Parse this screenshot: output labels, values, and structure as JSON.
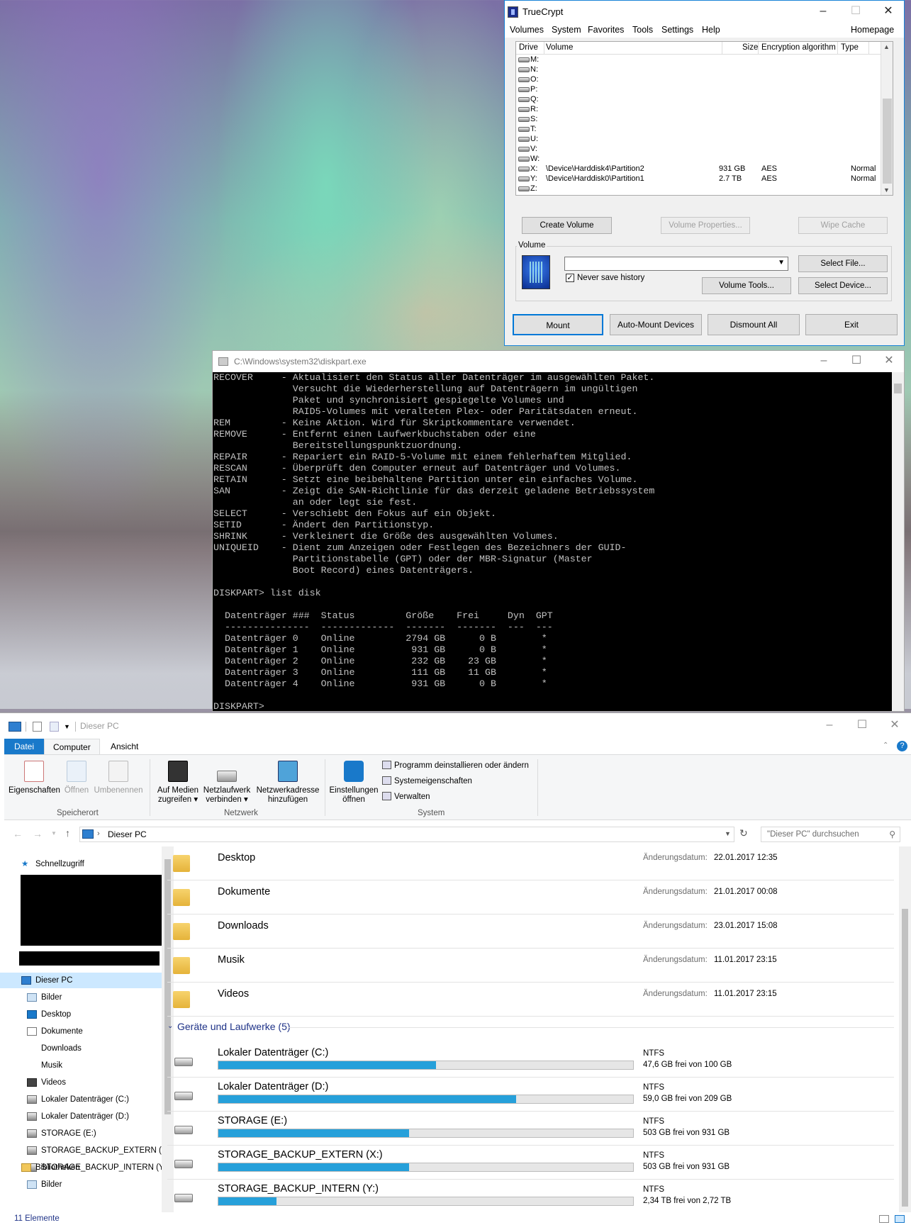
{
  "truecrypt": {
    "title": "TrueCrypt",
    "menu": [
      "Volumes",
      "System",
      "Favorites",
      "Tools",
      "Settings",
      "Help"
    ],
    "homepage": "Homepage",
    "columns": {
      "drive": "Drive",
      "volume": "Volume",
      "size": "Size",
      "algorithm": "Encryption algorithm",
      "type": "Type"
    },
    "rows": [
      {
        "drive": "M:",
        "volume": "",
        "size": "",
        "algorithm": "",
        "type": ""
      },
      {
        "drive": "N:",
        "volume": "",
        "size": "",
        "algorithm": "",
        "type": ""
      },
      {
        "drive": "O:",
        "volume": "",
        "size": "",
        "algorithm": "",
        "type": ""
      },
      {
        "drive": "P:",
        "volume": "",
        "size": "",
        "algorithm": "",
        "type": ""
      },
      {
        "drive": "Q:",
        "volume": "",
        "size": "",
        "algorithm": "",
        "type": ""
      },
      {
        "drive": "R:",
        "volume": "",
        "size": "",
        "algorithm": "",
        "type": ""
      },
      {
        "drive": "S:",
        "volume": "",
        "size": "",
        "algorithm": "",
        "type": ""
      },
      {
        "drive": "T:",
        "volume": "",
        "size": "",
        "algorithm": "",
        "type": ""
      },
      {
        "drive": "U:",
        "volume": "",
        "size": "",
        "algorithm": "",
        "type": ""
      },
      {
        "drive": "V:",
        "volume": "",
        "size": "",
        "algorithm": "",
        "type": ""
      },
      {
        "drive": "W:",
        "volume": "",
        "size": "",
        "algorithm": "",
        "type": ""
      },
      {
        "drive": "X:",
        "volume": "\\Device\\Harddisk4\\Partition2",
        "size": "931 GB",
        "algorithm": "AES",
        "type": "Normal"
      },
      {
        "drive": "Y:",
        "volume": "\\Device\\Harddisk0\\Partition1",
        "size": "2.7 TB",
        "algorithm": "AES",
        "type": "Normal"
      },
      {
        "drive": "Z:",
        "volume": "",
        "size": "",
        "algorithm": "",
        "type": ""
      }
    ],
    "buttons": {
      "create_volume": "Create Volume",
      "volume_properties": "Volume Properties...",
      "wipe_cache": "Wipe Cache",
      "select_file": "Select File...",
      "volume_tools": "Volume Tools...",
      "select_device": "Select Device...",
      "mount": "Mount",
      "auto_mount": "Auto-Mount Devices",
      "dismount_all": "Dismount All",
      "exit": "Exit"
    },
    "volume_group_label": "Volume",
    "never_save_history": "Never save history",
    "never_save_history_checked": true,
    "volume_path": ""
  },
  "console": {
    "title": "C:\\Windows\\system32\\diskpart.exe",
    "lines": [
      "RECOVER     - Aktualisiert den Status aller Datenträger im ausgewählten Paket.",
      "              Versucht die Wiederherstellung auf Datenträgern im ungültigen",
      "              Paket und synchronisiert gespiegelte Volumes und",
      "              RAID5-Volumes mit veralteten Plex- oder Paritätsdaten erneut.",
      "REM         - Keine Aktion. Wird für Skriptkommentare verwendet.",
      "REMOVE      - Entfernt einen Laufwerkbuchstaben oder eine",
      "              Bereitstellungspunktzuordnung.",
      "REPAIR      - Repariert ein RAID-5-Volume mit einem fehlerhaftem Mitglied.",
      "RESCAN      - Überprüft den Computer erneut auf Datenträger und Volumes.",
      "RETAIN      - Setzt eine beibehaltene Partition unter ein einfaches Volume.",
      "SAN         - Zeigt die SAN-Richtlinie für das derzeit geladene Betriebssystem",
      "              an oder legt sie fest.",
      "SELECT      - Verschiebt den Fokus auf ein Objekt.",
      "SETID       - Ändert den Partitionstyp.",
      "SHRINK      - Verkleinert die Größe des ausgewählten Volumes.",
      "UNIQUEID    - Dient zum Anzeigen oder Festlegen des Bezeichners der GUID-",
      "              Partitionstabelle (GPT) oder der MBR-Signatur (Master",
      "              Boot Record) eines Datenträgers.",
      "",
      "DISKPART> list disk",
      "",
      "  Datenträger ###  Status         Größe    Frei     Dyn  GPT",
      "  ---------------  -------------  -------  -------  ---  ---",
      "  Datenträger 0    Online         2794 GB      0 B        *",
      "  Datenträger 1    Online          931 GB      0 B        *",
      "  Datenträger 2    Online          232 GB    23 GB        *",
      "  Datenträger 3    Online          111 GB    11 GB        *",
      "  Datenträger 4    Online          931 GB      0 B        *",
      "",
      "DISKPART>"
    ]
  },
  "explorer": {
    "title": "Dieser PC",
    "tabs": {
      "file": "Datei",
      "computer": "Computer",
      "view": "Ansicht"
    },
    "ribbon": {
      "properties": "Eigenschaften",
      "open": "Öffnen",
      "rename": "Umbenennen",
      "group_location": "Speicherort",
      "media_line1": "Auf Medien",
      "media_line2": "zugreifen",
      "netdrive_line1": "Netzlaufwerk",
      "netdrive_line2": "verbinden",
      "netaddr_line1": "Netzwerkadresse",
      "netaddr_line2": "hinzufügen",
      "group_network": "Netzwerk",
      "settings_line1": "Einstellungen",
      "settings_line2": "öffnen",
      "uninstall": "Programm deinstallieren oder ändern",
      "sysprops": "Systemeigenschaften",
      "manage": "Verwalten",
      "group_system": "System"
    },
    "address": "Dieser PC",
    "search_placeholder": "\"Dieser PC\" durchsuchen",
    "nav": {
      "quick_access": "Schnellzugriff",
      "this_pc": "Dieser PC",
      "items": [
        "Bilder",
        "Desktop",
        "Dokumente",
        "Downloads",
        "Musik",
        "Videos",
        "Lokaler Datenträger (C:)",
        "Lokaler Datenträger (D:)",
        "STORAGE (E:)",
        "STORAGE_BACKUP_EXTERN (X:)",
        "STORAGE_BACKUP_INTERN (Y:)"
      ],
      "libraries": "Bibliotheken",
      "lib_items": [
        "Bilder"
      ]
    },
    "date_label": "Änderungsdatum:",
    "folders": [
      {
        "name": "Desktop",
        "date": "22.01.2017 12:35"
      },
      {
        "name": "Dokumente",
        "date": "21.01.2017 00:08"
      },
      {
        "name": "Downloads",
        "date": "23.01.2017 15:08"
      },
      {
        "name": "Musik",
        "date": "11.01.2017 23:15"
      },
      {
        "name": "Videos",
        "date": "11.01.2017 23:15"
      }
    ],
    "devices_header": "Geräte und Laufwerke (5)",
    "drives": [
      {
        "name": "Lokaler Datenträger (C:)",
        "fs": "NTFS",
        "free": "47,6 GB frei von 100 GB",
        "used_fraction": 0.524
      },
      {
        "name": "Lokaler Datenträger (D:)",
        "fs": "NTFS",
        "free": "59,0 GB frei von 209 GB",
        "used_fraction": 0.718
      },
      {
        "name": "STORAGE (E:)",
        "fs": "NTFS",
        "free": "503 GB frei von 931 GB",
        "used_fraction": 0.46
      },
      {
        "name": "STORAGE_BACKUP_EXTERN (X:)",
        "fs": "NTFS",
        "free": "503 GB frei von 931 GB",
        "used_fraction": 0.46
      },
      {
        "name": "STORAGE_BACKUP_INTERN (Y:)",
        "fs": "NTFS",
        "free": "2,34 TB frei von 2,72 TB",
        "used_fraction": 0.14
      }
    ],
    "status": "11 Elemente",
    "accent_color": "#26a0da"
  }
}
